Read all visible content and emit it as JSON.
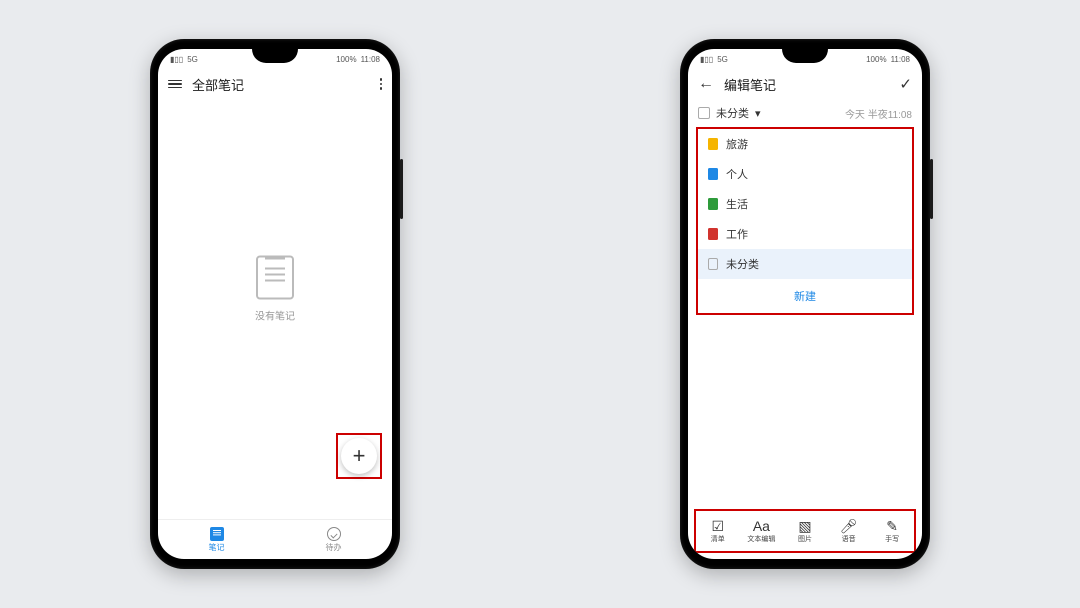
{
  "status": {
    "left_signal": "5G",
    "battery": "100%",
    "time": "11:08",
    "battery_icon_label": "⌧"
  },
  "phoneA": {
    "title": "全部笔记",
    "empty_label": "没有笔记",
    "fab_glyph": "+",
    "nav": {
      "notes_label": "笔记",
      "todo_label": "待办"
    }
  },
  "phoneB": {
    "title": "编辑笔记",
    "category_selected": "未分类",
    "dropdown_arrow": "▾",
    "timestamp": "今天 半夜11:08",
    "categories": [
      {
        "name": "旅游",
        "color": "#f5b400"
      },
      {
        "name": "个人",
        "color": "#1e88e5"
      },
      {
        "name": "生活",
        "color": "#2e9b3b"
      },
      {
        "name": "工作",
        "color": "#d1332e"
      }
    ],
    "uncategorized_label": "未分类",
    "new_label": "新建",
    "tools": {
      "checklist": "清单",
      "text": "文本编辑",
      "image": "图片",
      "voice": "语音",
      "hand": "手写"
    }
  }
}
